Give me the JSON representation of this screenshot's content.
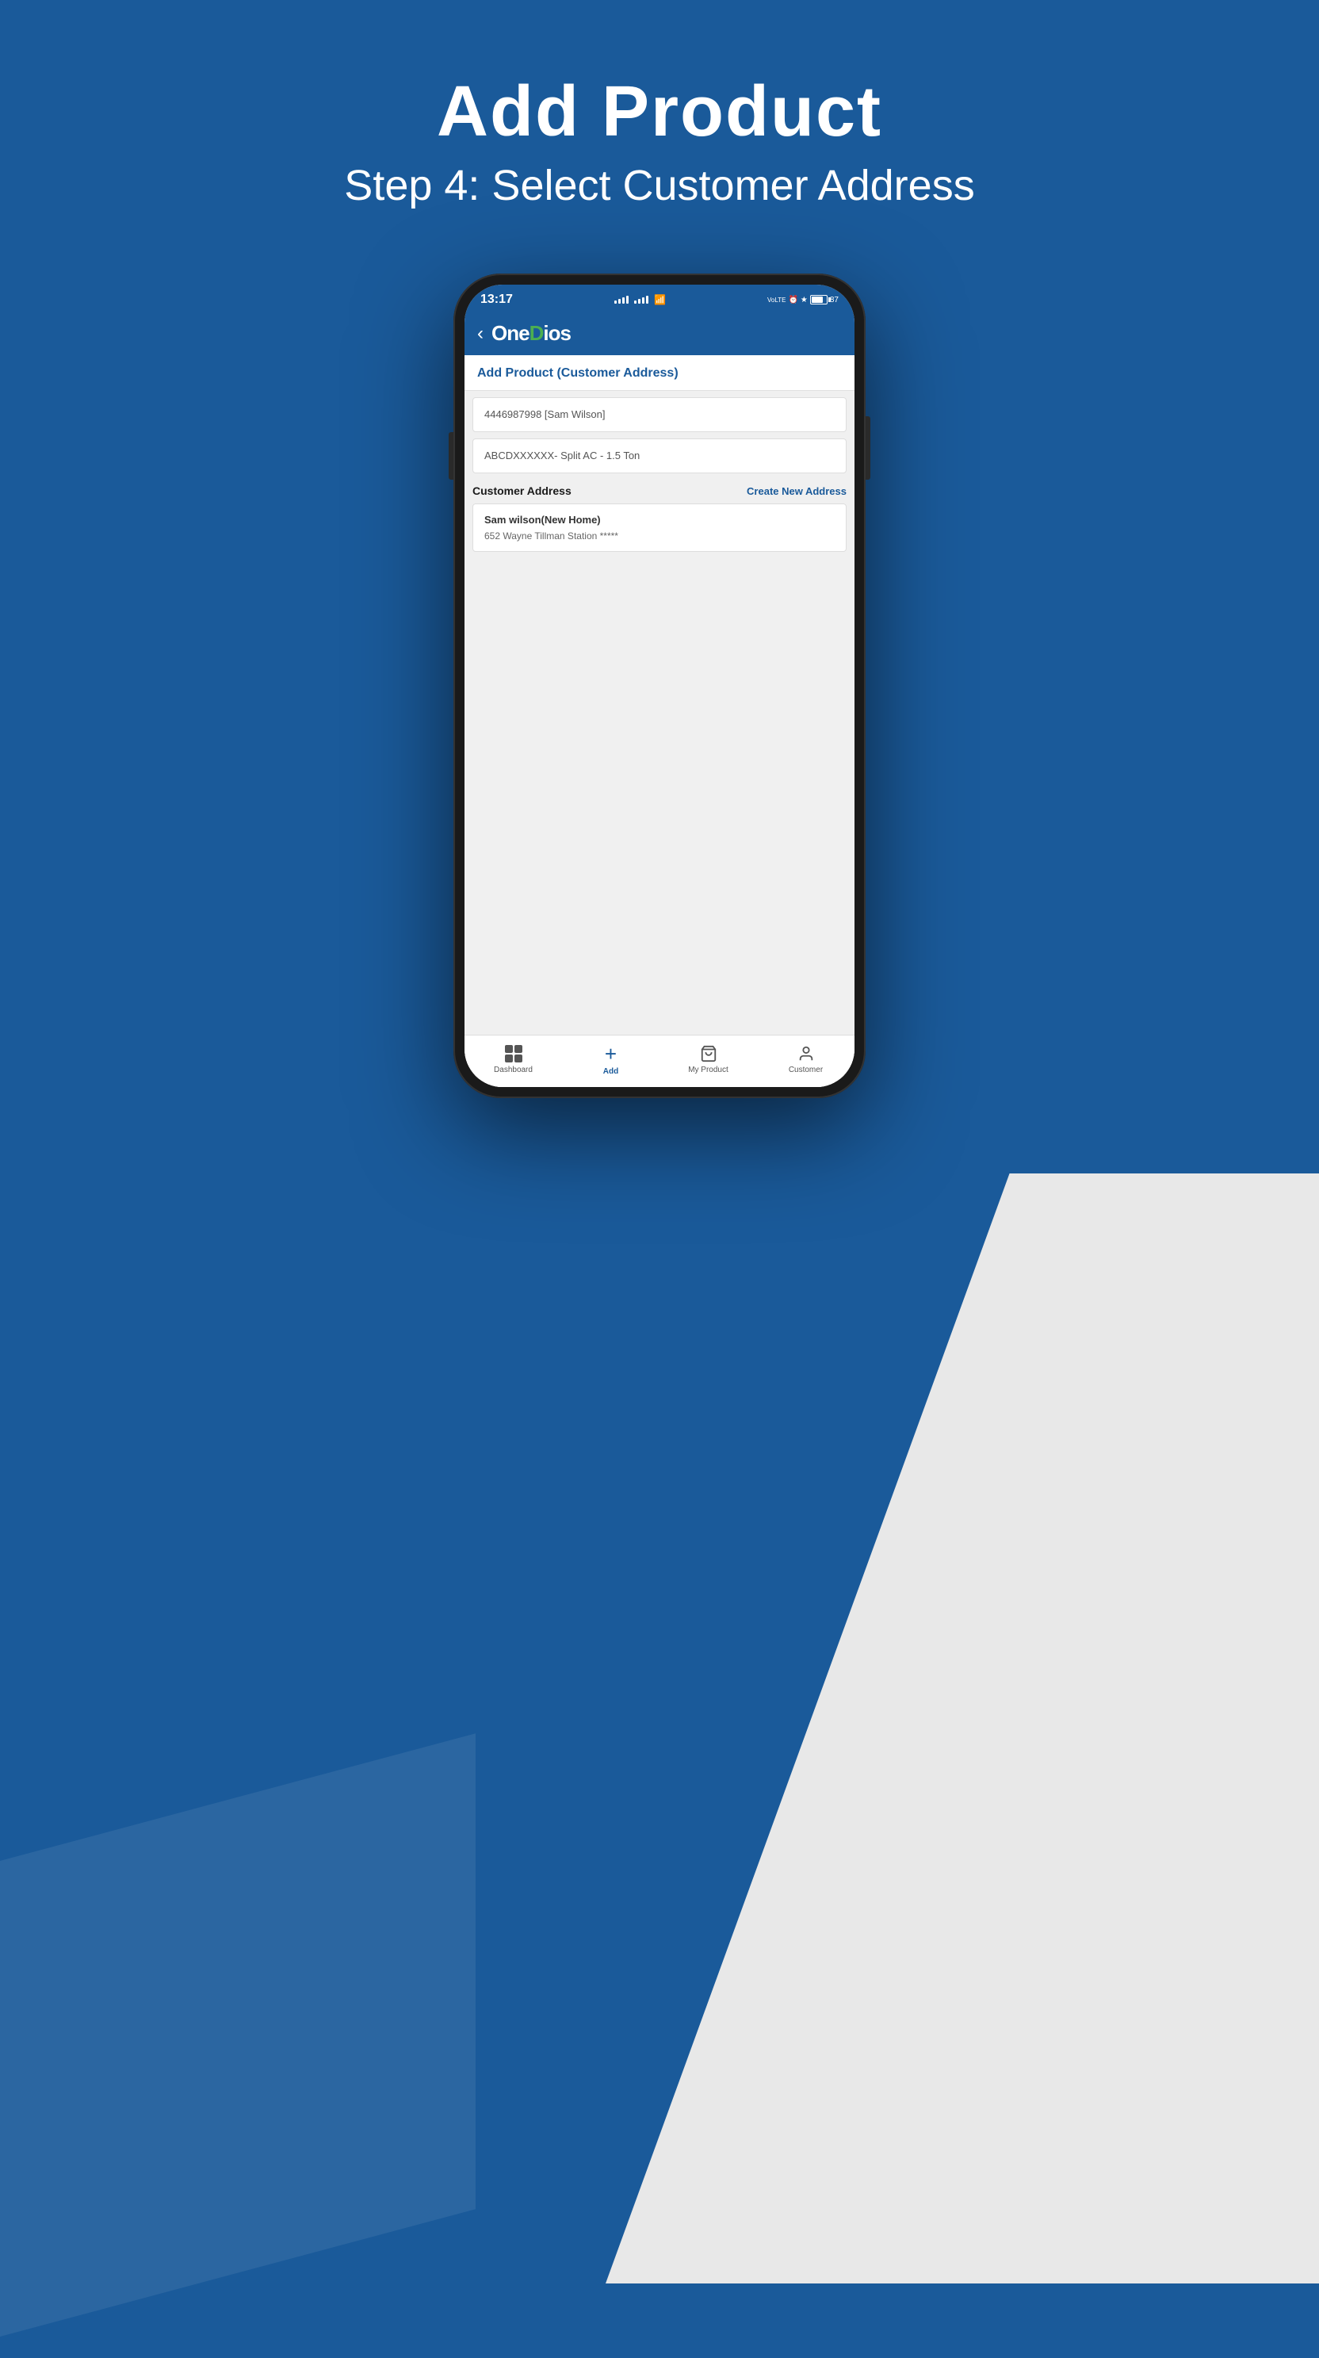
{
  "page": {
    "title": "Add Product",
    "subtitle": "Step 4: Select Customer Address"
  },
  "phone": {
    "status_bar": {
      "time": "13:17",
      "battery_percent": "87"
    }
  },
  "app": {
    "logo": "OneDios",
    "logo_colored_letter": "D",
    "header_section_title": "Add Product (Customer Address)",
    "field1_value": "4446987998 [Sam Wilson]",
    "field2_value": "ABCDXXXXXX- Split AC - 1.5 Ton",
    "customer_address_label": "Customer Address",
    "create_new_address_label": "Create New Address",
    "address_card": {
      "name": "Sam wilson(New Home)",
      "detail": "652 Wayne Tillman Station *****"
    }
  },
  "bottom_nav": {
    "items": [
      {
        "label": "Dashboard",
        "icon": "dashboard",
        "active": false
      },
      {
        "label": "Add",
        "icon": "add",
        "active": true
      },
      {
        "label": "My Product",
        "icon": "cart",
        "active": false
      },
      {
        "label": "Customer",
        "icon": "person",
        "active": false
      }
    ]
  }
}
